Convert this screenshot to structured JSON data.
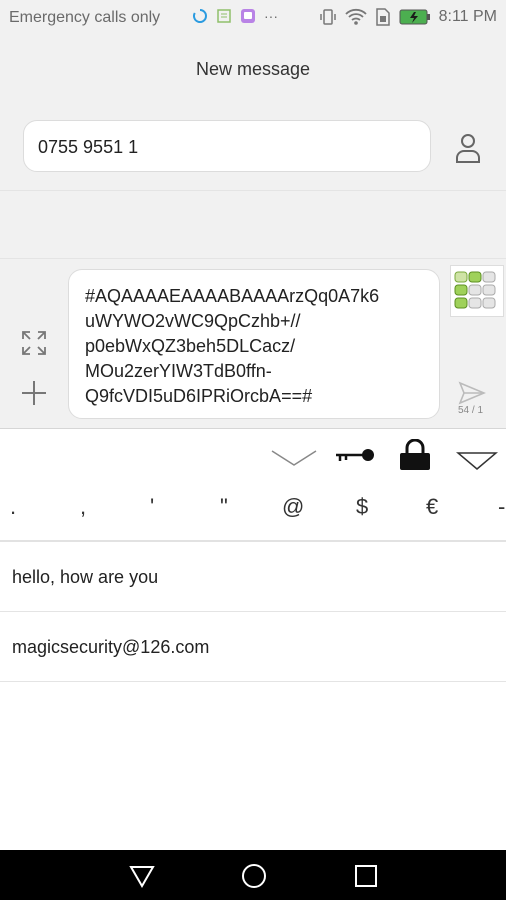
{
  "status_bar": {
    "carrier_text": "Emergency calls only",
    "time": "8:11 PM",
    "icons": [
      "sync-icon",
      "app-notification-icon",
      "app-notification-icon",
      "more-dots-icon",
      "vibrate-icon",
      "wifi-icon",
      "sim-icon",
      "battery-charging-icon"
    ],
    "more_dots": "···"
  },
  "header": {
    "title": "New message"
  },
  "recipient": {
    "value": "0755 9551 1",
    "contact_icon": "person-icon"
  },
  "compose": {
    "message": "#AQAAAAEAAAABAAAArzQq0A7k6\nuWYWO2vWC9QpCzhb+//\np0ebWxQZ3beh5DLCacz/\nMOu2zerYIW3TdB0ffn-\nQ9fcVDI5uD6IPRiOrcbA==#",
    "char_count": "54 / 1",
    "expand_icon": "expand-icon",
    "add_icon": "plus-icon",
    "send_icon": "send-icon"
  },
  "keyboard_toolbar": {
    "icons": [
      "chevron-down-icon",
      "key-icon",
      "lock-icon",
      "triangle-down-icon"
    ]
  },
  "symbols": [
    ".",
    ",",
    "'",
    "\"",
    "@",
    "$",
    "€",
    "-"
  ],
  "suggestions": [
    "hello, how are you",
    "magicsecurity@126.com"
  ],
  "nav": {
    "icons": [
      "back-icon",
      "home-icon",
      "recents-icon"
    ]
  }
}
